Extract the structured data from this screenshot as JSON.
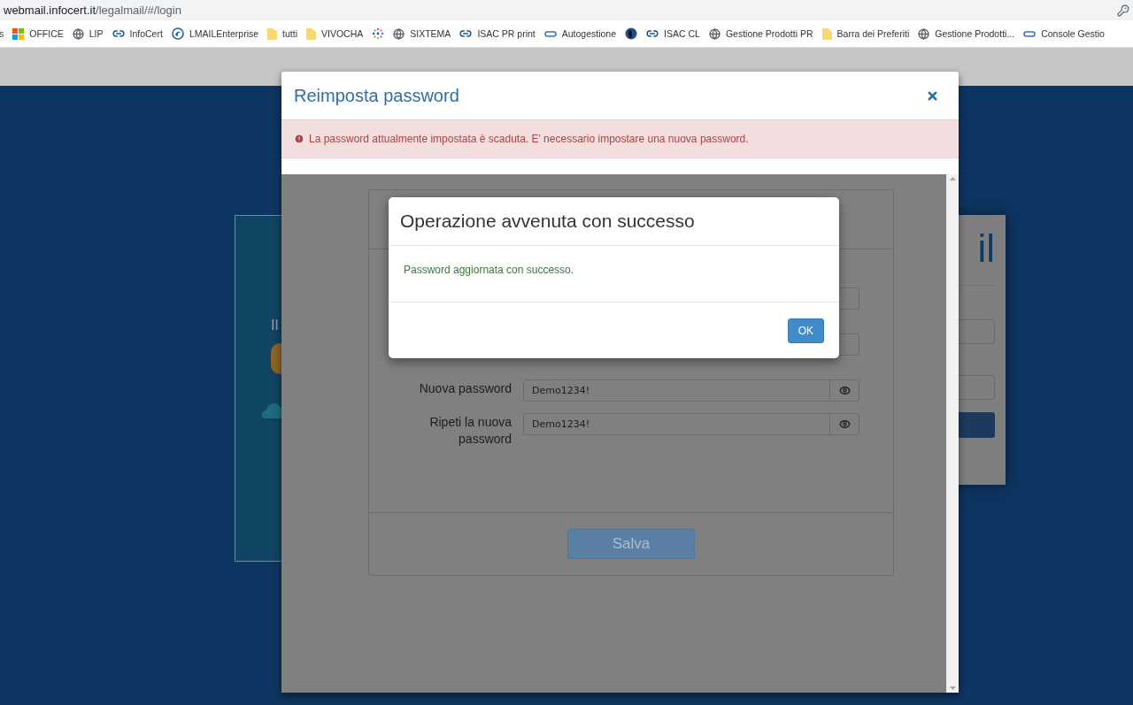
{
  "browser": {
    "url_host": "webmail.infocert.it",
    "url_path": "/legalmail/#/login",
    "bookmarks": [
      {
        "label": "s",
        "kind": "none"
      },
      {
        "label": "OFFICE",
        "kind": "windows"
      },
      {
        "label": "LIP",
        "kind": "globe"
      },
      {
        "label": "InfoCert",
        "kind": "link"
      },
      {
        "label": "LMAILEnterprise",
        "kind": "circle"
      },
      {
        "label": "tutti",
        "kind": "folder"
      },
      {
        "label": "VIVOCHA",
        "kind": "folder"
      },
      {
        "kind": "dots"
      },
      {
        "label": "SIXTEMA",
        "kind": "globe"
      },
      {
        "label": "ISAC PR print",
        "kind": "link"
      },
      {
        "label": "Autogestione",
        "kind": "pill"
      },
      {
        "kind": "earth"
      },
      {
        "label": "ISAC CL",
        "kind": "link"
      },
      {
        "label": "Gestione Prodotti PR",
        "kind": "globe"
      },
      {
        "label": "Barra dei Preferiti",
        "kind": "folder"
      },
      {
        "label": "Gestione Prodotti...",
        "kind": "globe"
      },
      {
        "label": "Console Gestio",
        "kind": "pill"
      }
    ]
  },
  "background": {
    "left_card": {
      "subtitle": "Il"
    },
    "right_card": {
      "title": "il"
    }
  },
  "reset_modal": {
    "title": "Reimposta password",
    "alert": "La password attualmente impostata è scaduta. E' necessario impostare una nuova password.",
    "form": {
      "fields": [
        {
          "kind": "covered"
        },
        {
          "kind": "covered"
        },
        {
          "kind": "password",
          "label": "Nuova password",
          "value": "Demo1234!"
        },
        {
          "kind": "password",
          "label": "Ripeti la nuova password",
          "value": "Demo1234!"
        }
      ],
      "save_button": "Salva"
    }
  },
  "success_modal": {
    "title": "Operazione avvenuta con successo",
    "message": "Password aggiornata con successo.",
    "ok_button": "OK"
  }
}
